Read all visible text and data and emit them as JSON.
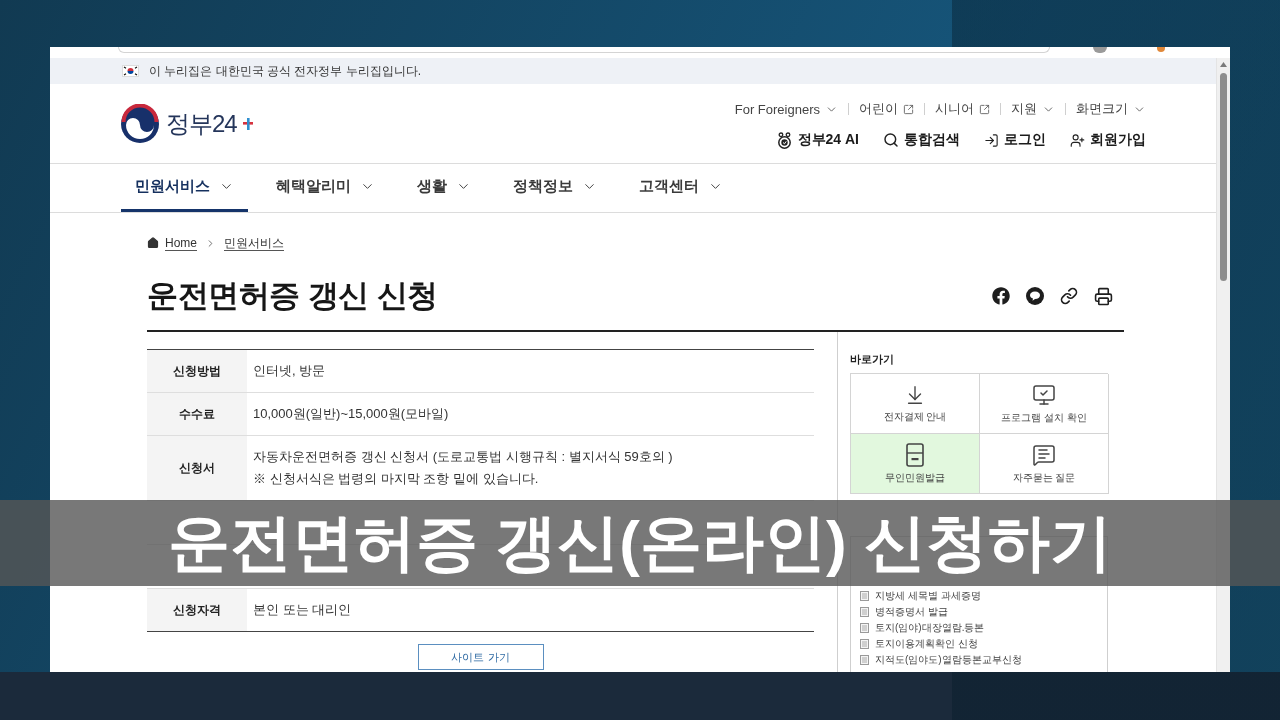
{
  "gov_notice": {
    "text": "이 누리집은 대한민국 공식 전자정부 누리집입니다."
  },
  "header": {
    "logo": {
      "text": "정부24"
    },
    "utility_links": [
      {
        "label": "For Foreigners",
        "kind": "dropdown"
      },
      {
        "label": "어린이",
        "kind": "external"
      },
      {
        "label": "시니어",
        "kind": "external"
      },
      {
        "label": "지원",
        "kind": "dropdown"
      },
      {
        "label": "화면크기",
        "kind": "dropdown"
      }
    ],
    "actions": [
      {
        "label": "정부24 AI",
        "kind": "ai"
      },
      {
        "label": "통합검색",
        "kind": "search"
      },
      {
        "label": "로그인",
        "kind": "login"
      },
      {
        "label": "회원가입",
        "kind": "signup"
      }
    ]
  },
  "nav": {
    "items": [
      {
        "label": "민원서비스",
        "selected": true
      },
      {
        "label": "혜택알리미",
        "selected": false
      },
      {
        "label": "생활",
        "selected": false
      },
      {
        "label": "정책정보",
        "selected": false
      },
      {
        "label": "고객센터",
        "selected": false
      }
    ]
  },
  "breadcrumb": [
    {
      "label": "Home",
      "kind": "home"
    },
    {
      "label": "민원서비스",
      "kind": "page"
    }
  ],
  "page": {
    "title": "운전면허증 갱신 신청"
  },
  "info_table": {
    "rows": [
      {
        "kind": "text",
        "label": "신청방법",
        "lines": [
          "인터넷, 방문"
        ]
      },
      {
        "kind": "text",
        "label": "수수료",
        "lines": [
          "10,000원(일반)~15,000원(모바일)"
        ]
      },
      {
        "kind": "text",
        "label": "신청서",
        "lines": [
          "자동차운전면허증 갱신 신청서 (도로교통법 시행규칙 : 별지서식 59호의 )",
          "※ 신청서식은 법령의 마지막 조항 밑에 있습니다."
        ]
      },
      {
        "kind": "covered"
      },
      {
        "kind": "covered"
      },
      {
        "kind": "text",
        "label": "신청자격",
        "lines": [
          "본인 또는 대리인"
        ]
      }
    ]
  },
  "site_button": {
    "label": "사이트 가기"
  },
  "sidebar": {
    "quick_title": "바로가기",
    "quick_links": [
      {
        "label": "전자결제 안내",
        "kind": "payment",
        "selected": false
      },
      {
        "label": "프로그램 설치 확인",
        "kind": "program",
        "selected": false
      },
      {
        "label": "무인민원발급",
        "kind": "kiosk",
        "selected": true
      },
      {
        "label": "자주묻는 질문",
        "kind": "faq",
        "selected": false
      }
    ],
    "popular_items": [
      "지방세 세목별 과세증명",
      "병적증명서 발급",
      "토지(임야)대장열람.등본",
      "토지이용계획확인 신청",
      "지적도(임야도)열람등본교부신청"
    ]
  },
  "title_banner": {
    "text": "운전면허증 갱신(온라인) 신청하기"
  }
}
